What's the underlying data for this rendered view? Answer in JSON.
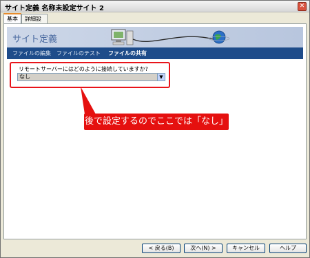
{
  "window": {
    "title": "サイト定義 名称未設定サイト 2",
    "close_label": "✕"
  },
  "tabs": [
    {
      "label": "基本"
    },
    {
      "label": "詳細設定"
    }
  ],
  "banner": {
    "title": "サイト定義"
  },
  "nav": {
    "items": [
      {
        "label": "ファイルの編集"
      },
      {
        "label": "ファイルのテスト"
      },
      {
        "label": "ファイルの共有"
      }
    ]
  },
  "form": {
    "question": "リモートサーバーにはどのように接続していますか?",
    "selected_value": "なし"
  },
  "annotation": {
    "text": "後で設定するのでここでは「なし」",
    "color": "#e5100f"
  },
  "buttons": {
    "back": "< 戻る(B)",
    "next": "次へ(N) >",
    "cancel": "キャンセル",
    "help": "ヘルプ"
  }
}
